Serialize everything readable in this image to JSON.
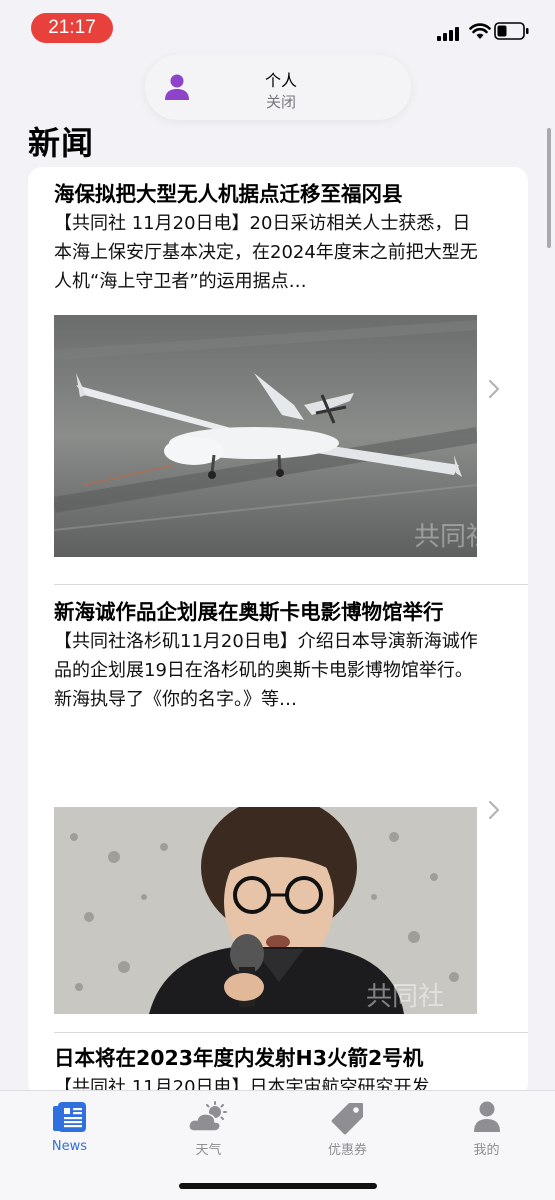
{
  "status_bar": {
    "time": "21:17"
  },
  "focus": {
    "title": "个人",
    "subtitle": "关闭"
  },
  "page_title": "新闻",
  "news": [
    {
      "title": "海保拟把大型无人机据点迁移至福冈县",
      "summary": "【共同社 11月20日电】20日采访相关人士获悉，日本海上保安厅基本决定，在2024年度末之前把大型无人机“海上守卫者”的运用据点…",
      "image_watermark": "共同社"
    },
    {
      "title": "新海诚作品企划展在奥斯卡电影博物馆举行",
      "summary": "【共同社洛杉矶11月20日电】介绍日本导演新海诚作品的企划展19日在洛杉矶的奥斯卡电影博物馆举行。新海执导了《你的名字。》等…",
      "image_watermark": "共同社"
    },
    {
      "title": "日本将在2023年度内发射H3火箭2号机",
      "summary": "【共同社 11月20日电】日本宇宙航空研究开发"
    }
  ],
  "tabs": [
    {
      "label": "News",
      "icon": "newspaper-icon",
      "active": true
    },
    {
      "label": "天气",
      "icon": "cloud-sun-icon",
      "active": false
    },
    {
      "label": "优惠券",
      "icon": "tag-icon",
      "active": false
    },
    {
      "label": "我的",
      "icon": "person-icon",
      "active": false
    }
  ],
  "colors": {
    "accent": "#2f6fde",
    "time_pill": "#e8413c",
    "focus_icon": "#8e44c8"
  }
}
